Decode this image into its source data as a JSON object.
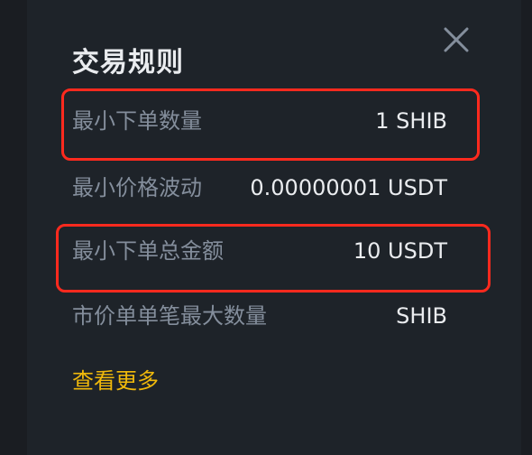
{
  "dialog": {
    "title": "交易规则",
    "close_icon": "close-icon",
    "rows": [
      {
        "label": "最小下单数量",
        "value": "1 SHIB"
      },
      {
        "label": "最小价格波动",
        "value": "0.00000001 USDT"
      },
      {
        "label": "最小下单总金额",
        "value": "10 USDT"
      },
      {
        "label": "市价单单笔最大数量",
        "value": "SHIB"
      }
    ],
    "more_link": "查看更多"
  },
  "colors": {
    "panel_bg": "#1e2329",
    "label": "#848e9c",
    "value": "#eaecef",
    "accent": "#f0b90b",
    "highlight_border": "#ff2a1e"
  }
}
